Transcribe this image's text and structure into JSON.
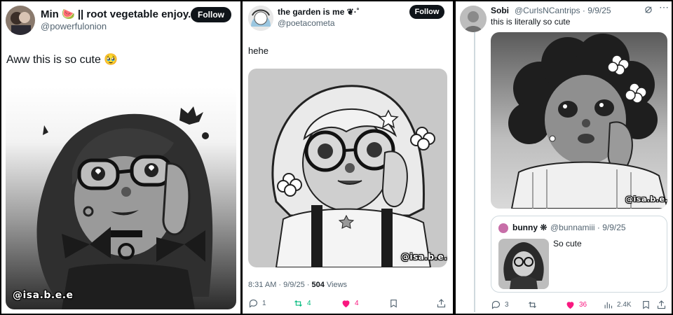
{
  "panel1": {
    "author_name": "Min 🍉 || root vegetable enjoy...",
    "handle": "@powerfulonion",
    "follow_label": "Follow",
    "text": "Aww this is so cute 🥹",
    "watermark": "@isa.b.e.e"
  },
  "panel2": {
    "author_name": "the garden is me ❦·˚",
    "handle": "@poetacometa",
    "follow_label": "Follow",
    "text": "hehe",
    "watermark": "@isa.b.e.e",
    "timestamp": "8:31 AM · 9/9/25 · ",
    "views_count": "504",
    "views_label": " Views",
    "actions": {
      "replies": "1",
      "reposts": "4",
      "likes": "4"
    },
    "icons": [
      "reply-icon",
      "repost-icon",
      "like-icon",
      "bookmark-icon",
      "share-icon"
    ]
  },
  "panel3": {
    "author_name": "Sobi",
    "handle_and_date": "@CurlsNCantrips · 9/9/25",
    "text": "this is literally so cute",
    "watermark": "@isa.b.e.e",
    "quote": {
      "author_name": "bunny ❊",
      "handle_and_date": "@bunnamiii · 9/9/25",
      "text": "So cute"
    },
    "actions": {
      "replies": "3",
      "reposts": "",
      "likes": "36",
      "views": "2.4K"
    },
    "icons": [
      "grok-icon",
      "more-icon",
      "reply-icon",
      "repost-icon",
      "like-icon",
      "views-icon",
      "bookmark-icon",
      "share-icon"
    ]
  },
  "colors": {
    "like": "#f91880",
    "repost": "#00ba7c",
    "text": "#0f1419",
    "muted": "#536471"
  }
}
